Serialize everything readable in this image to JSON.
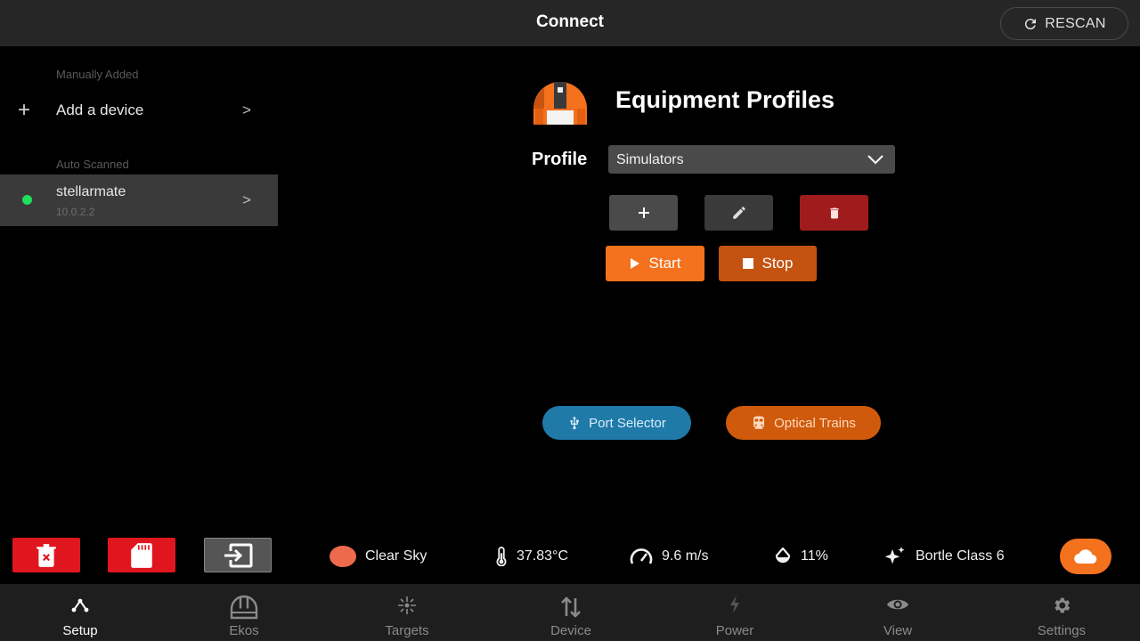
{
  "header": {
    "title": "Connect",
    "rescan_label": "RESCAN"
  },
  "sidebar": {
    "manual_section": "Manually Added",
    "add_device_label": "Add a device",
    "auto_section": "Auto Scanned",
    "devices": [
      {
        "name": "stellarmate",
        "ip": "10.0.2.2",
        "status_color": "#1ee05a"
      }
    ]
  },
  "profiles": {
    "title": "Equipment Profiles",
    "profile_label": "Profile",
    "selected_profile": "Simulators",
    "start_label": "Start",
    "stop_label": "Stop",
    "port_selector_label": "Port Selector",
    "optical_trains_label": "Optical Trains"
  },
  "status_bar": {
    "sky": "Clear Sky",
    "temperature": "37.83°C",
    "wind": "9.6 m/s",
    "humidity": "11%",
    "bortle": "Bortle Class 6"
  },
  "nav": {
    "items": [
      {
        "label": "Setup",
        "icon": "setup-icon"
      },
      {
        "label": "Ekos",
        "icon": "observatory-icon"
      },
      {
        "label": "Targets",
        "icon": "targets-icon"
      },
      {
        "label": "Device",
        "icon": "device-icon"
      },
      {
        "label": "Power",
        "icon": "power-icon"
      },
      {
        "label": "View",
        "icon": "eye-icon"
      },
      {
        "label": "Settings",
        "icon": "gear-icon"
      }
    ],
    "active": "Setup"
  },
  "colors": {
    "accent": "#f4711d",
    "danger": "#e0161f",
    "port_selector": "#1f7aa8",
    "optical_trains": "#cf5a0c",
    "online": "#1ee05a"
  }
}
